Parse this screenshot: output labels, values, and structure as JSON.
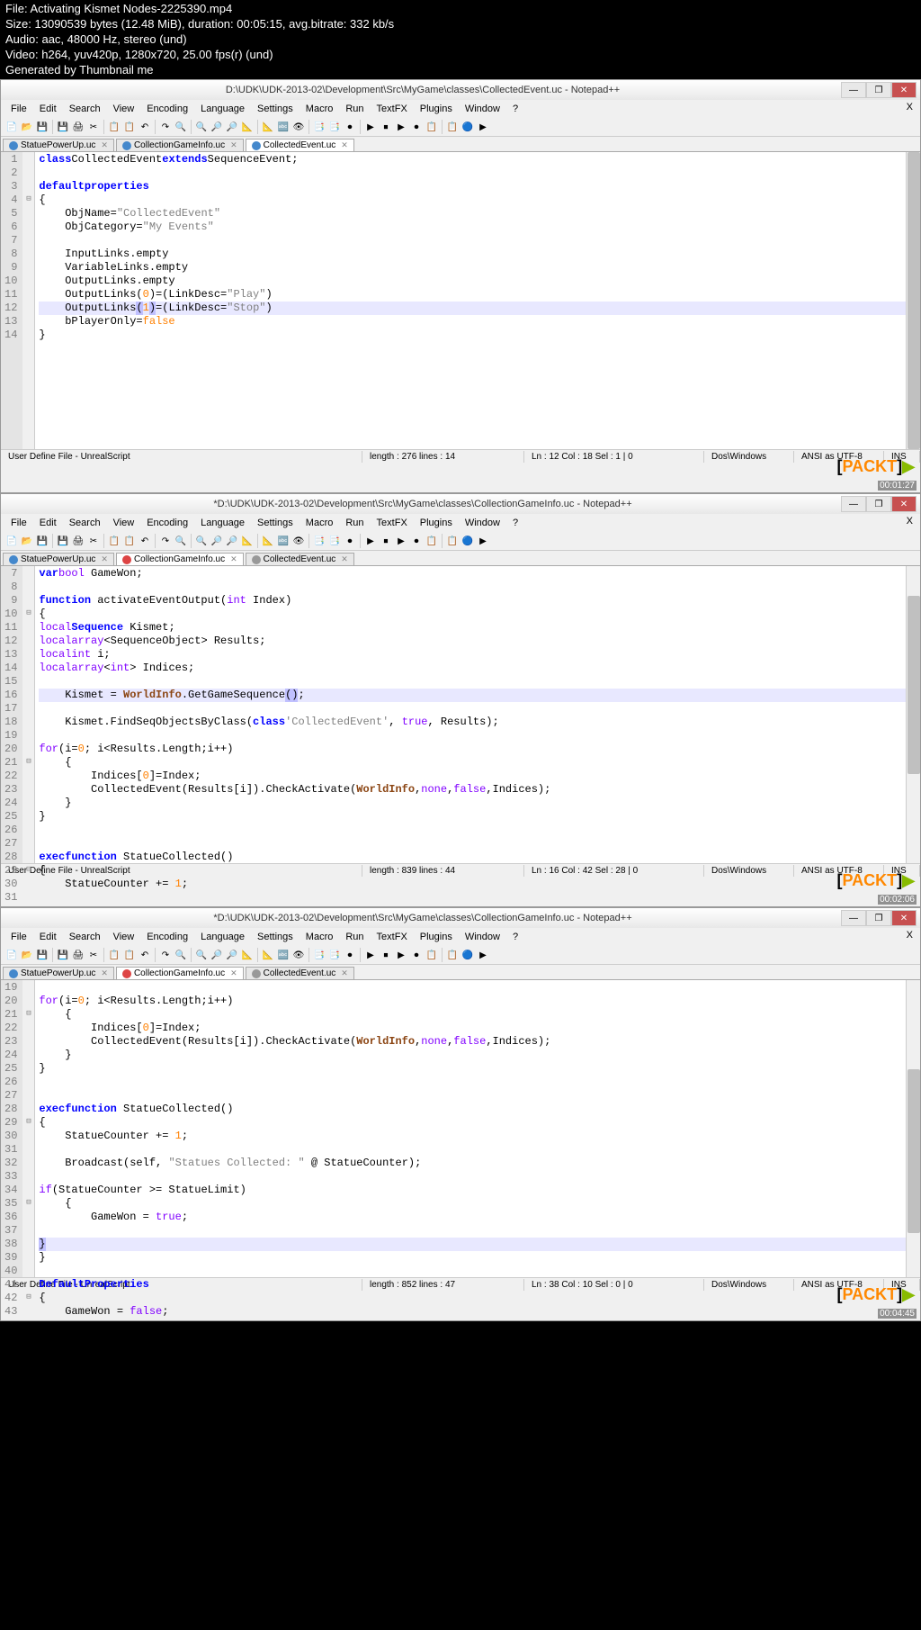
{
  "meta": {
    "file": "File: Activating Kismet Nodes-2225390.mp4",
    "size": "Size: 13090539 bytes (12.48 MiB), duration: 00:05:15, avg.bitrate: 332 kb/s",
    "audio": "Audio: aac, 48000 Hz, stereo (und)",
    "video": "Video: h264, yuv420p, 1280x720, 25.00 fps(r) (und)",
    "gen": "Generated by Thumbnail me"
  },
  "menus": [
    "File",
    "Edit",
    "Search",
    "View",
    "Encoding",
    "Language",
    "Settings",
    "Macro",
    "Run",
    "TextFX",
    "Plugins",
    "Window",
    "?"
  ],
  "toolbar_icons": [
    "📄",
    "📂",
    "💾",
    "💾",
    "🖨",
    "✂",
    "📋",
    "📋",
    "↶",
    "↷",
    "🔍",
    "🔍",
    "🔎",
    "🔎",
    "📐",
    "📐",
    "🔤",
    "👁",
    "📑",
    "📑",
    "⏺",
    "▶",
    "⏹",
    "▶",
    "⏺",
    "📋",
    "📋",
    "🔵",
    "▶"
  ],
  "win1": {
    "title": "D:\\UDK\\UDK-2013-02\\Development\\Src\\MyGame\\classes\\CollectedEvent.uc - Notepad++",
    "tabs": [
      {
        "label": "StatuePowerUp.uc",
        "dot": "blue",
        "active": false
      },
      {
        "label": "CollectionGameInfo.uc",
        "dot": "blue",
        "active": false
      },
      {
        "label": "CollectedEvent.uc",
        "dot": "blue",
        "active": true
      }
    ],
    "lines": [
      {
        "n": 1,
        "html": "<span class='kw'>class</span> <span class='cls'>CollectedEvent</span> <span class='kw'>extends</span> <span class='cls'>SequenceEvent</span>;"
      },
      {
        "n": 2,
        "html": ""
      },
      {
        "n": 3,
        "html": "<span class='kw'>defaultproperties</span>"
      },
      {
        "n": 4,
        "html": "<span class='fold'>⊟</span>{"
      },
      {
        "n": 5,
        "html": "    ObjName=<span class='str'>\"CollectedEvent\"</span>"
      },
      {
        "n": 6,
        "html": "    ObjCategory=<span class='str'>\"My Events\"</span>"
      },
      {
        "n": 7,
        "html": ""
      },
      {
        "n": 8,
        "html": "    InputLinks.empty"
      },
      {
        "n": 9,
        "html": "    VariableLinks.empty"
      },
      {
        "n": 10,
        "html": "    OutputLinks.empty"
      },
      {
        "n": 11,
        "html": "    OutputLinks(<span class='num'>0</span>)=(LinkDesc=<span class='str'>\"Play\"</span>)"
      },
      {
        "n": 12,
        "hl": true,
        "html": "    OutputLinks<span class='paren-hl'>(</span><span class='num'>1</span><span class='paren-hl'>)</span>=(LinkDesc=<span class='str'>\"Stop\"</span>)"
      },
      {
        "n": 13,
        "html": "    bPlayerOnly=<span class='num'>false</span>"
      },
      {
        "n": 14,
        "html": "}"
      }
    ],
    "status": {
      "lang": "User Define File - UnrealScript",
      "len": "length : 276    lines : 14",
      "pos": "Ln : 12    Col : 18    Sel : 1 | 0",
      "eol": "Dos\\Windows",
      "enc": "ANSI as UTF-8",
      "mode": "INS"
    },
    "ts": "00:01:27"
  },
  "win2": {
    "title": "*D:\\UDK\\UDK-2013-02\\Development\\Src\\MyGame\\classes\\CollectionGameInfo.uc - Notepad++",
    "tabs": [
      {
        "label": "StatuePowerUp.uc",
        "dot": "blue",
        "active": false
      },
      {
        "label": "CollectionGameInfo.uc",
        "dot": "red",
        "active": true
      },
      {
        "label": "CollectedEvent.uc",
        "dot": "grey",
        "active": false
      }
    ],
    "lines": [
      {
        "n": 7,
        "html": "<span class='kw'>var</span> <span class='kw2'>bool</span> GameWon;"
      },
      {
        "n": 8,
        "html": ""
      },
      {
        "n": 9,
        "html": "<span class='kw'>function</span> activateEventOutput(<span class='kw2'>int</span> Index)"
      },
      {
        "n": 10,
        "html": "<span class='fold'>⊟</span>{"
      },
      {
        "n": 11,
        "html": "    <span class='kw2'>local</span> <span class='kw'>Sequence</span> Kismet;"
      },
      {
        "n": 12,
        "html": "    <span class='kw2'>local</span> <span class='kw2'>array</span>&lt;SequenceObject&gt; Results;"
      },
      {
        "n": 13,
        "html": "    <span class='kw2'>local</span> <span class='kw2'>int</span> i;"
      },
      {
        "n": 14,
        "html": "    <span class='kw2'>local</span> <span class='kw2'>array</span>&lt;<span class='kw2'>int</span>&gt; Indices;"
      },
      {
        "n": 15,
        "html": ""
      },
      {
        "n": 16,
        "hl": true,
        "html": "    Kismet = <span class='wi'>WorldInfo</span>.GetGameSequence<span class='paren-hl'>(</span><span class='paren-hl'>)</span>;"
      },
      {
        "n": 17,
        "html": ""
      },
      {
        "n": 18,
        "html": "    Kismet.FindSeqObjectsByClass(<span class='kw'>class</span><span class='str'>'CollectedEvent'</span>, <span class='kw2'>true</span>, Results);"
      },
      {
        "n": 19,
        "html": ""
      },
      {
        "n": 20,
        "html": "    <span class='kw2'>for</span>(i=<span class='num'>0</span>; i&lt;Results.Length;i++)"
      },
      {
        "n": 21,
        "html": "<span class='fold'>⊟</span>    {"
      },
      {
        "n": 22,
        "html": "        Indices[<span class='num'>0</span>]=Index;"
      },
      {
        "n": 23,
        "html": "        CollectedEvent(Results[i]).CheckActivate(<span class='wi'>WorldInfo</span>,<span class='kw2'>none</span>,<span class='kw2'>false</span>,Indices);"
      },
      {
        "n": 24,
        "html": "    }"
      },
      {
        "n": 25,
        "html": "}"
      },
      {
        "n": 26,
        "html": ""
      },
      {
        "n": 27,
        "html": ""
      },
      {
        "n": 28,
        "html": "<span class='kw'>exec</span> <span class='kw'>function</span> StatueCollected()"
      },
      {
        "n": 29,
        "html": "<span class='fold'>⊟</span>{"
      },
      {
        "n": 30,
        "html": "    StatueCounter += <span class='num'>1</span>;"
      },
      {
        "n": 31,
        "html": ""
      }
    ],
    "status": {
      "lang": "User Define File - UnrealScript",
      "len": "length : 839    lines : 44",
      "pos": "Ln : 16    Col : 42    Sel : 28 | 0",
      "eol": "Dos\\Windows",
      "enc": "ANSI as UTF-8",
      "mode": "INS"
    },
    "ts": "00:02:06"
  },
  "win3": {
    "title": "*D:\\UDK\\UDK-2013-02\\Development\\Src\\MyGame\\classes\\CollectionGameInfo.uc - Notepad++",
    "tabs": [
      {
        "label": "StatuePowerUp.uc",
        "dot": "blue",
        "active": false
      },
      {
        "label": "CollectionGameInfo.uc",
        "dot": "red",
        "active": true
      },
      {
        "label": "CollectedEvent.uc",
        "dot": "grey",
        "active": false
      }
    ],
    "lines": [
      {
        "n": 19,
        "html": ""
      },
      {
        "n": 20,
        "html": "    <span class='kw2'>for</span>(i=<span class='num'>0</span>; i&lt;Results.Length;i++)"
      },
      {
        "n": 21,
        "html": "<span class='fold'>⊟</span>    {"
      },
      {
        "n": 22,
        "html": "        Indices[<span class='num'>0</span>]=Index;"
      },
      {
        "n": 23,
        "html": "        CollectedEvent(Results[i]).CheckActivate(<span class='wi'>WorldInfo</span>,<span class='kw2'>none</span>,<span class='kw2'>false</span>,Indices);"
      },
      {
        "n": 24,
        "html": "    }"
      },
      {
        "n": 25,
        "html": "}"
      },
      {
        "n": 26,
        "html": ""
      },
      {
        "n": 27,
        "html": ""
      },
      {
        "n": 28,
        "html": "<span class='kw'>exec</span> <span class='kw'>function</span> StatueCollected()"
      },
      {
        "n": 29,
        "html": "<span class='fold'>⊟</span>{"
      },
      {
        "n": 30,
        "html": "    StatueCounter += <span class='num'>1</span>;"
      },
      {
        "n": 31,
        "html": ""
      },
      {
        "n": 32,
        "html": "    Broadcast(self, <span class='str'>\"Statues Collected: \"</span> @ StatueCounter);"
      },
      {
        "n": 33,
        "html": ""
      },
      {
        "n": 34,
        "html": "    <span class='kw2'>if</span>(StatueCounter &gt;= StatueLimit)"
      },
      {
        "n": 35,
        "html": "<span class='fold'>⊟</span>    {"
      },
      {
        "n": 36,
        "html": "        GameWon = <span class='kw2'>true</span>;"
      },
      {
        "n": 37,
        "html": ""
      },
      {
        "n": 38,
        "hl": true,
        "html": "        <span class='paren-hl'>}</span>"
      },
      {
        "n": 39,
        "html": "}"
      },
      {
        "n": 40,
        "html": ""
      },
      {
        "n": 41,
        "html": "<span class='kw'>DefaultProperties</span>"
      },
      {
        "n": 42,
        "html": "<span class='fold'>⊟</span>{"
      },
      {
        "n": 43,
        "html": "    GameWon = <span class='kw2'>false</span>;"
      }
    ],
    "status": {
      "lang": "User Define File - UnrealScript",
      "len": "length : 852    lines : 47",
      "pos": "Ln : 38    Col : 10    Sel : 0 | 0",
      "eol": "Dos\\Windows",
      "enc": "ANSI as UTF-8",
      "mode": "INS"
    },
    "ts": "00:04:45"
  },
  "packt": {
    "open": "[",
    "text": "PACKT",
    "close": "]",
    "arrow": "▶"
  }
}
